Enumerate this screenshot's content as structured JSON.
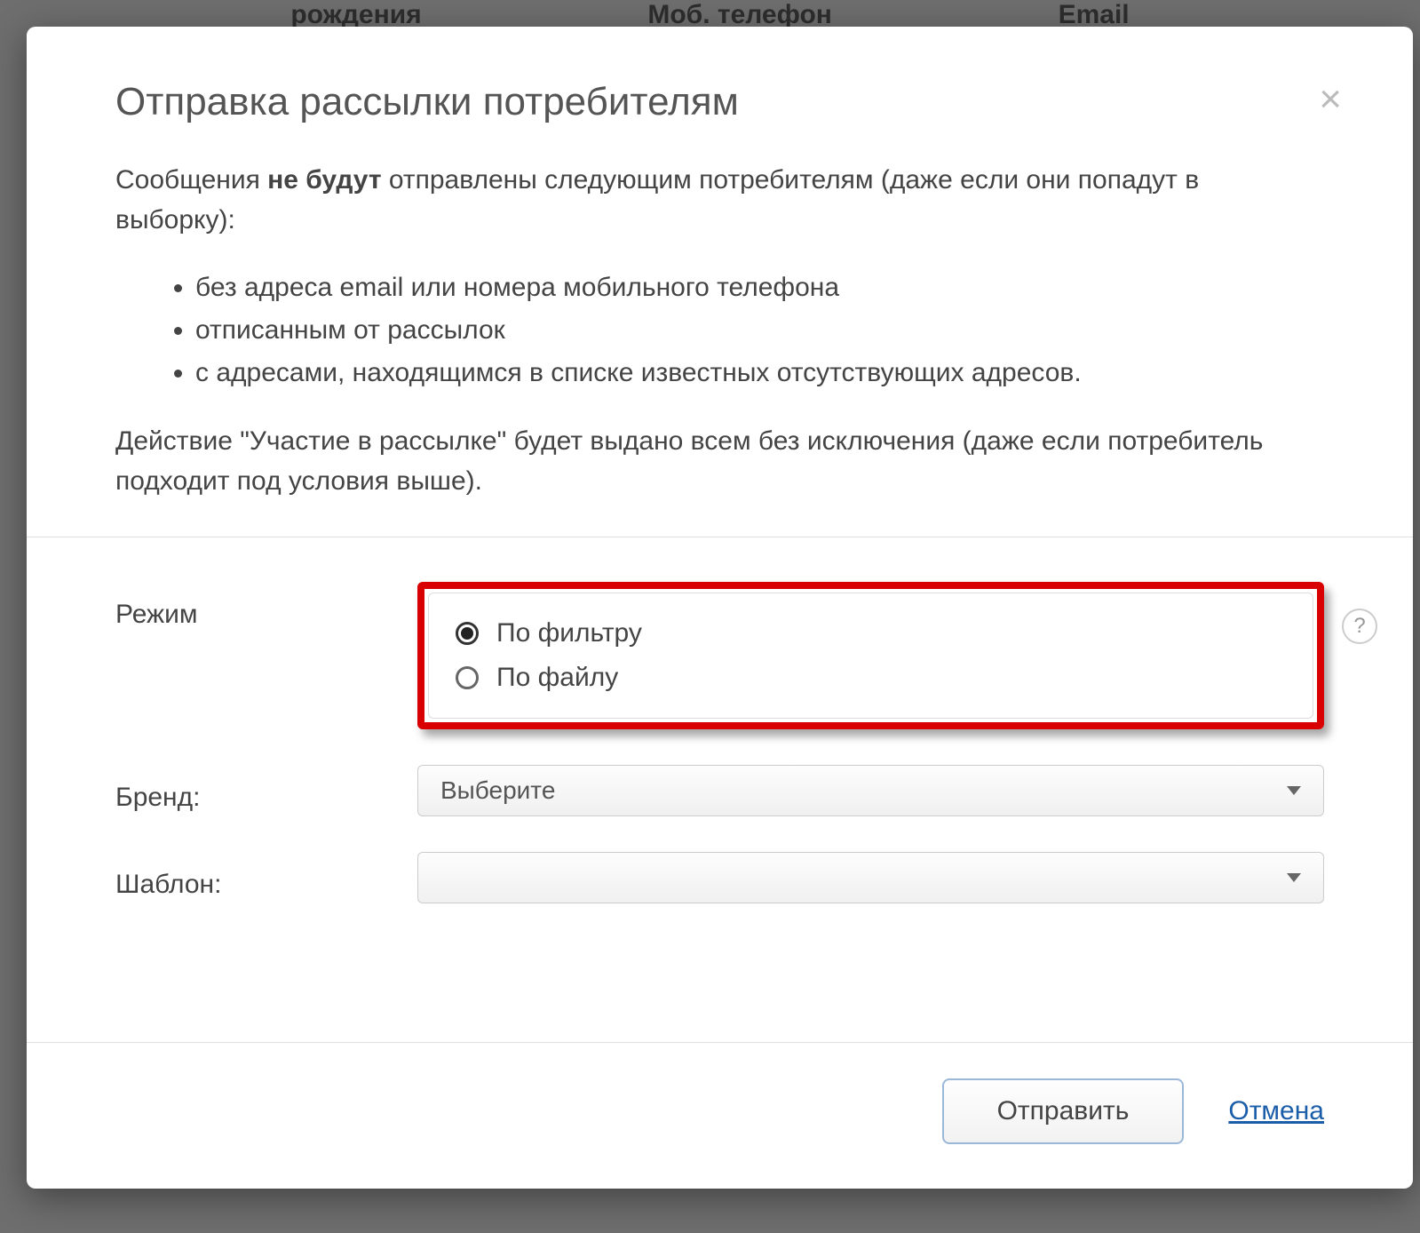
{
  "background_headers": {
    "col1": "рождения",
    "col2": "Моб. телефон",
    "col3": "Email"
  },
  "modal": {
    "title": "Отправка рассылки потребителям",
    "intro_prefix": "Сообщения ",
    "intro_bold": "не будут",
    "intro_suffix": " отправлены следующим потребителям (даже если они попадут в выборку):",
    "exclusions": [
      "без адреса email или номера мобильного телефона",
      "отписанным от рассылок",
      "с адресами, находящимся в списке известных отсутствующих адресов."
    ],
    "note": "Действие \"Участие в рассылке\" будет выдано всем без исключения (даже если потребитель подходит под условия выше).",
    "form": {
      "mode_label": "Режим",
      "mode_options": {
        "by_filter": "По фильтру",
        "by_file": "По файлу"
      },
      "mode_selected": "by_filter",
      "brand_label": "Бренд:",
      "brand_placeholder": "Выберите",
      "template_label": "Шаблон:",
      "template_placeholder": ""
    },
    "footer": {
      "submit": "Отправить",
      "cancel": "Отмена"
    },
    "help_tooltip": "?"
  }
}
